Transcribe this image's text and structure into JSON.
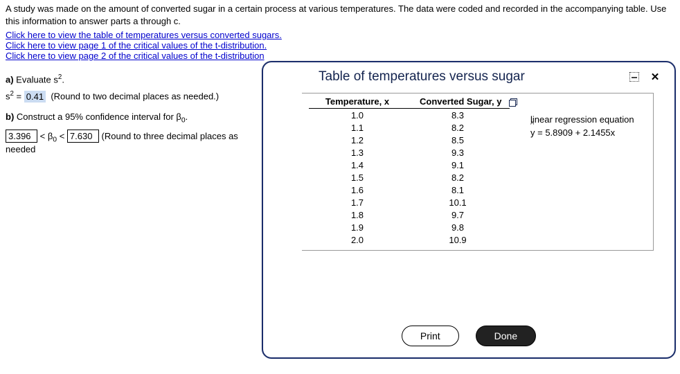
{
  "intro": "A study was made on the amount of converted sugar in a certain process at various temperatures. The data were coded and recorded in the accompanying table. Use this information to answer parts a through c.",
  "links": {
    "l1": "Click here to view the table of temperatures versus converted sugars.",
    "l2": "Click here to view page 1 of the critical values of the t-distribution.",
    "l3": "Click here to view page 2 of the critical values of the t-distribution"
  },
  "partA": {
    "prompt_prefix": "a) ",
    "prompt_text": "Evaluate s",
    "eq_lhs": "s",
    "eq_rhs": " = ",
    "answer": "0.41",
    "hint": "(Round to two decimal places as needed.)"
  },
  "partB": {
    "prompt_prefix": "b) ",
    "prompt_text": "Construct a 95% confidence interval for β",
    "lo": "3.396",
    "mid1": " < β",
    "mid2": " < ",
    "hi": "7.630",
    "hint": "(Round to three decimal places as needed"
  },
  "modal": {
    "title": "Table of temperatures versus sugar",
    "col1": "Temperature, x",
    "col2": "Converted Sugar, y",
    "rows": [
      {
        "x": "1.0",
        "y": "8.3"
      },
      {
        "x": "1.1",
        "y": "8.2"
      },
      {
        "x": "1.2",
        "y": "8.5"
      },
      {
        "x": "1.3",
        "y": "9.3"
      },
      {
        "x": "1.4",
        "y": "9.1"
      },
      {
        "x": "1.5",
        "y": "8.2"
      },
      {
        "x": "1.6",
        "y": "8.1"
      },
      {
        "x": "1.7",
        "y": "10.1"
      },
      {
        "x": "1.8",
        "y": "9.7"
      },
      {
        "x": "1.9",
        "y": "9.8"
      },
      {
        "x": "2.0",
        "y": "10.9"
      }
    ],
    "regress_label": "linear regression equation",
    "regress_eq_lhs": "y",
    "regress_eq_rhs": " = 5.8909 + 2.1455x",
    "print": "Print",
    "done": "Done"
  },
  "chart_data": {
    "type": "table",
    "title": "Table of temperatures versus sugar",
    "columns": [
      "Temperature, x",
      "Converted Sugar, y"
    ],
    "x": [
      1.0,
      1.1,
      1.2,
      1.3,
      1.4,
      1.5,
      1.6,
      1.7,
      1.8,
      1.9,
      2.0
    ],
    "y": [
      8.3,
      8.2,
      8.5,
      9.3,
      9.1,
      8.2,
      8.1,
      10.1,
      9.7,
      9.8,
      10.9
    ],
    "regression": {
      "intercept": 5.8909,
      "slope": 2.1455,
      "equation": "y_hat = 5.8909 + 2.1455x"
    }
  }
}
